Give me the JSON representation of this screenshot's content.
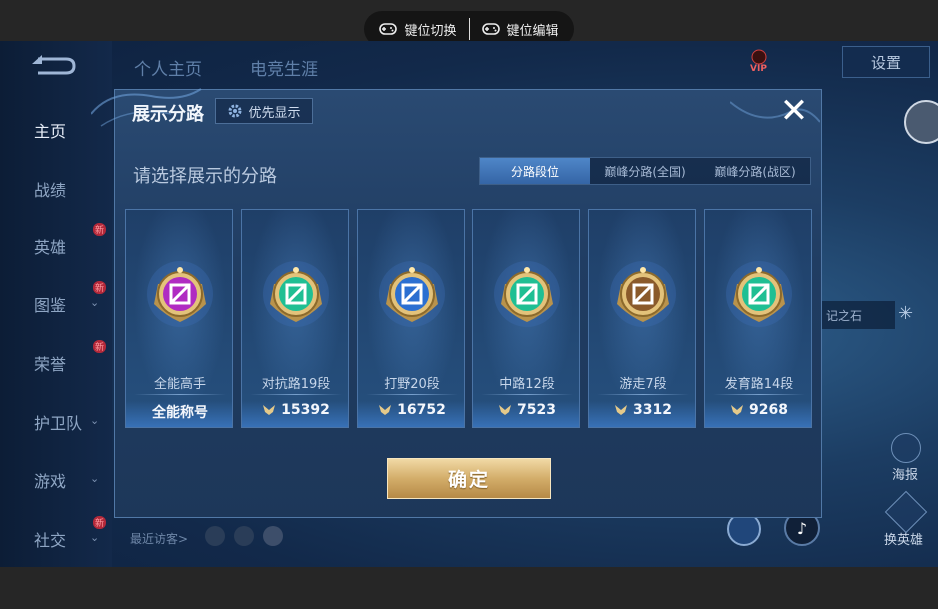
{
  "overlay": {
    "key_switch_label": "键位切换",
    "key_edit_label": "键位编辑"
  },
  "header": {
    "tabs": [
      "个人主页",
      "电竞生涯"
    ],
    "settings_label": "设置",
    "vip_label": "VIP"
  },
  "sidebar": {
    "items": [
      {
        "label": "主页",
        "active": true,
        "chevron": false,
        "new_badge": false
      },
      {
        "label": "战绩",
        "active": false,
        "chevron": false,
        "new_badge": false
      },
      {
        "label": "英雄",
        "active": false,
        "chevron": false,
        "new_badge": true
      },
      {
        "label": "图鉴",
        "active": false,
        "chevron": true,
        "new_badge": true
      },
      {
        "label": "荣誉",
        "active": false,
        "chevron": false,
        "new_badge": true
      },
      {
        "label": "护卫队",
        "active": false,
        "chevron": true,
        "new_badge": false
      },
      {
        "label": "游戏",
        "active": false,
        "chevron": true,
        "new_badge": false
      },
      {
        "label": "社交",
        "active": false,
        "chevron": true,
        "new_badge": true
      }
    ],
    "new_badge_text": "新"
  },
  "background": {
    "recent_visitors": "最近访客>",
    "stone_label": "记之石",
    "poster_label": "海报",
    "change_hero_label": "换英雄"
  },
  "dialog": {
    "title": "展示分路",
    "priority_button": "优先显示",
    "subtitle": "请选择展示的分路",
    "close_icon": "close-icon",
    "tabs": [
      {
        "label": "分路段位",
        "active": true
      },
      {
        "label": "巅峰分路(全国)",
        "active": false
      },
      {
        "label": "巅峰分路(战区)",
        "active": false
      }
    ],
    "cards": [
      {
        "name": "全能高手",
        "score": "全能称号",
        "has_points_icon": false,
        "emblem_color": "#b02bc2",
        "emblem": "all-round-emblem-icon"
      },
      {
        "name": "对抗路19段",
        "score": "15392",
        "has_points_icon": true,
        "emblem_color": "#1fbf93",
        "emblem": "clash-lane-emblem-icon"
      },
      {
        "name": "打野20段",
        "score": "16752",
        "has_points_icon": true,
        "emblem_color": "#2b6fd1",
        "emblem": "jungle-emblem-icon"
      },
      {
        "name": "中路12段",
        "score": "7523",
        "has_points_icon": true,
        "emblem_color": "#1fbf93",
        "emblem": "mid-lane-emblem-icon"
      },
      {
        "name": "游走7段",
        "score": "3312",
        "has_points_icon": true,
        "emblem_color": "#8a5a2b",
        "emblem": "roam-emblem-icon"
      },
      {
        "name": "发育路14段",
        "score": "9268",
        "has_points_icon": true,
        "emblem_color": "#1fbf93",
        "emblem": "farm-lane-emblem-icon"
      }
    ],
    "confirm_button": "确定"
  },
  "colors": {
    "accent_blue": "#3f73b5",
    "gold": "#d3ad6a",
    "dialog_bg": "#223f66"
  }
}
